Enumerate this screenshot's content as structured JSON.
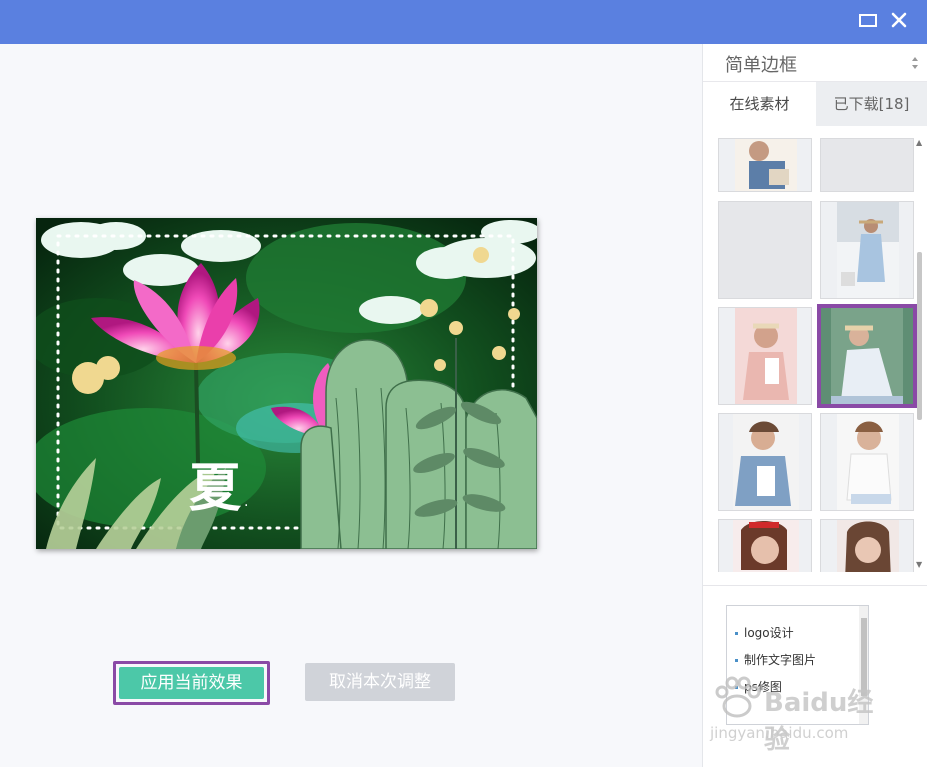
{
  "window": {
    "maximize_icon": "maximize-icon",
    "close_icon": "close-icon"
  },
  "colors": {
    "titlebar": "#5a80e0",
    "accent_green": "#4cc8a8",
    "highlight_purple": "#8a4aa6"
  },
  "preview": {
    "title_char": "夏"
  },
  "buttons": {
    "apply": "应用当前效果",
    "cancel": "取消本次调整"
  },
  "sidebar": {
    "dropdown_label": "简单边框",
    "tabs": [
      {
        "label": "在线素材",
        "active": true
      },
      {
        "label": "已下载[18]",
        "active": false
      }
    ],
    "links": [
      "logo设计",
      "制作文字图片",
      "ps修图"
    ]
  },
  "watermark": {
    "brand": "Baidu经验",
    "url": "jingyan.baidu.com"
  }
}
